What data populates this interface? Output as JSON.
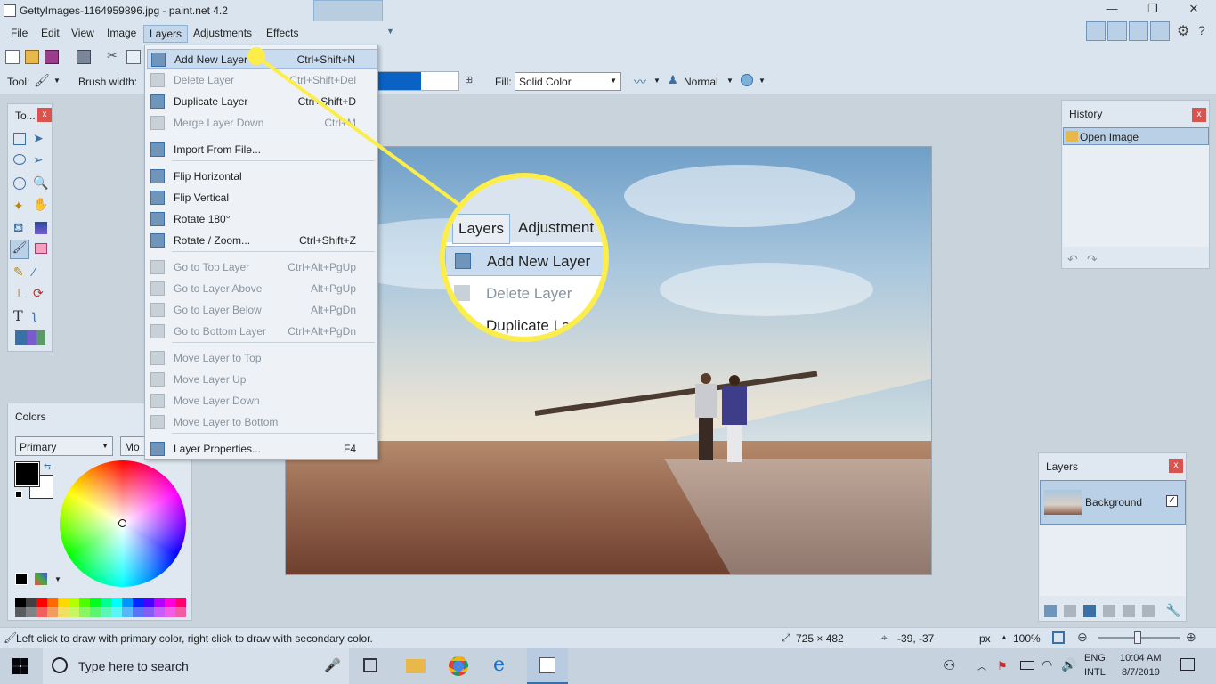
{
  "window": {
    "title": "GettyImages-1164959896.jpg - paint.net 4.2",
    "min_glyph": "—",
    "max_glyph": "❐",
    "close_glyph": "✕"
  },
  "menu": {
    "items": [
      "File",
      "Edit",
      "View",
      "Image",
      "Layers",
      "Adjustments",
      "Effects"
    ],
    "active": "Layers"
  },
  "toolbar": {
    "tool_label": "Tool:",
    "brush_width_label": "Brush width:",
    "fill_label": "Fill:",
    "fill_value": "Solid Color",
    "blend_value": "Normal"
  },
  "layers_menu": {
    "items": [
      {
        "label": "Add New Layer",
        "shortcut": "Ctrl+Shift+N",
        "state": "highlighted"
      },
      {
        "label": "Delete Layer",
        "shortcut": "Ctrl+Shift+Del",
        "state": "disabled"
      },
      {
        "label": "Duplicate Layer",
        "shortcut": "Ctrl+Shift+D",
        "state": "enabled"
      },
      {
        "label": "Merge Layer Down",
        "shortcut": "Ctrl+M",
        "state": "disabled"
      },
      {
        "label": "Import From File...",
        "shortcut": "",
        "state": "enabled"
      },
      {
        "label": "Flip Horizontal",
        "shortcut": "",
        "state": "enabled"
      },
      {
        "label": "Flip Vertical",
        "shortcut": "",
        "state": "enabled"
      },
      {
        "label": "Rotate 180°",
        "shortcut": "",
        "state": "enabled"
      },
      {
        "label": "Rotate / Zoom...",
        "shortcut": "Ctrl+Shift+Z",
        "state": "enabled"
      },
      {
        "label": "Go to Top Layer",
        "shortcut": "Ctrl+Alt+PgUp",
        "state": "disabled"
      },
      {
        "label": "Go to Layer Above",
        "shortcut": "Alt+PgUp",
        "state": "disabled"
      },
      {
        "label": "Go to Layer Below",
        "shortcut": "Alt+PgDn",
        "state": "disabled"
      },
      {
        "label": "Go to Bottom Layer",
        "shortcut": "Ctrl+Alt+PgDn",
        "state": "disabled"
      },
      {
        "label": "Move Layer to Top",
        "shortcut": "",
        "state": "disabled"
      },
      {
        "label": "Move Layer Up",
        "shortcut": "",
        "state": "disabled"
      },
      {
        "label": "Move Layer Down",
        "shortcut": "",
        "state": "disabled"
      },
      {
        "label": "Move Layer to Bottom",
        "shortcut": "",
        "state": "disabled"
      },
      {
        "label": "Layer Properties...",
        "shortcut": "F4",
        "state": "enabled"
      }
    ]
  },
  "callout": {
    "menu_layers": "Layers",
    "menu_adjust": "Adjustment",
    "item1": "Add New Layer",
    "item2": "Delete Layer",
    "item3": "Duplicate Layer"
  },
  "tools_panel": {
    "title": "To..."
  },
  "colors_panel": {
    "title": "Colors",
    "mode": "Primary",
    "more": "Mo"
  },
  "history_panel": {
    "title": "History",
    "items": [
      "Open Image"
    ]
  },
  "layers_panel": {
    "title": "Layers",
    "layers": [
      {
        "name": "Background",
        "visible": true
      }
    ]
  },
  "status": {
    "hint": "Left click to draw with primary color, right click to draw with secondary color.",
    "image_size": "725 × 482",
    "cursor_pos": "-39, -37",
    "unit": "px",
    "zoom": "100%"
  },
  "taskbar": {
    "search_placeholder": "Type here to search",
    "lang1": "ENG",
    "lang2": "INTL",
    "time": "10:04 AM",
    "date": "8/7/2019"
  },
  "colors": {
    "accent_yellow": "#fbee4a",
    "highlight": "#c9dbee",
    "palette": [
      "#000000",
      "#404040",
      "#ff0000",
      "#ff6a00",
      "#ffd800",
      "#b6ff00",
      "#4cff00",
      "#00ff21",
      "#00ff90",
      "#00ffff",
      "#0094ff",
      "#0026ff",
      "#4800ff",
      "#b200ff",
      "#ff00dc",
      "#ff006e"
    ]
  }
}
